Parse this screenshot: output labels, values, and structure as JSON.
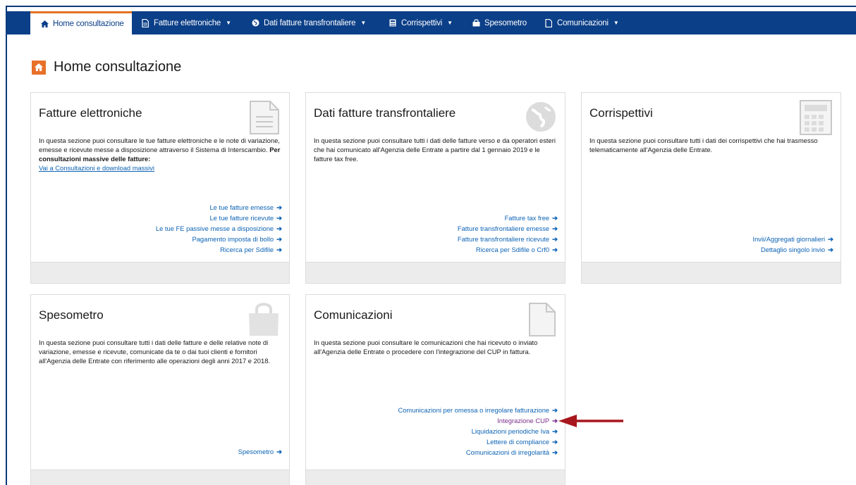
{
  "navbar": {
    "items": [
      {
        "label": "Home consultazione",
        "icon": "home-icon"
      },
      {
        "label": "Fatture elettroniche",
        "icon": "document-icon"
      },
      {
        "label": "Dati fatture transfrontaliere",
        "icon": "globe-icon"
      },
      {
        "label": "Corrispettivi",
        "icon": "calculator-icon"
      },
      {
        "label": "Spesometro",
        "icon": "shopping-bag-icon"
      },
      {
        "label": "Comunicazioni",
        "icon": "file-icon"
      }
    ]
  },
  "page": {
    "title": "Home consultazione"
  },
  "cards": {
    "fatture": {
      "title": "Fatture elettroniche",
      "desc_part1": "In questa sezione puoi consultare le tue fatture elettroniche e le note di variazione, emesse e ricevute messe a disposizione attraverso il Sistema di Interscambio. ",
      "desc_bold": "Per consultazioni massive delle fatture:",
      "desc_link": "Vai a Consultazioni e download massivi",
      "links": [
        "Le tue fatture emesse",
        "Le tue fatture ricevute",
        "Le tue FE passive messe a disposizione",
        "Pagamento imposta di bollo",
        "Ricerca per Sdifile"
      ]
    },
    "transfrontaliere": {
      "title": "Dati fatture transfrontaliere",
      "desc": "In questa sezione puoi consultare tutti i dati delle fatture verso e da operatori esteri che hai comunicato all'Agenzia delle Entrate a partire dal 1 gennaio 2019 e le fatture tax free.",
      "links": [
        "Fatture tax free",
        "Fatture transfrontaliere emesse",
        "Fatture transfrontaliere ricevute",
        "Ricerca per Sdifile o Crf0"
      ]
    },
    "corrispettivi": {
      "title": "Corrispettivi",
      "desc": "In questa sezione puoi consultare tutti i dati dei corrispettivi che hai trasmesso telematicamente all'Agenzia delle Entrate.",
      "links": [
        "Invii/Aggregati giornalieri",
        "Dettaglio singolo invio"
      ]
    },
    "spesometro": {
      "title": "Spesometro",
      "desc": "In questa sezione puoi consultare tutti i dati delle fatture e delle relative note di variazione, emesse e ricevute, comunicate da te o dai tuoi clienti e fornitori all'Agenzia delle Entrate con riferimento alle operazioni degli anni 2017 e 2018.",
      "links": [
        "Spesometro"
      ]
    },
    "comunicazioni": {
      "title": "Comunicazioni",
      "desc": "In questa sezione puoi consultare le comunicazioni che hai ricevuto o inviato all'Agenzia delle Entrate o procedere con l'integrazione del CUP in fattura.",
      "links": [
        "Comunicazioni per omessa o irregolare fatturazione",
        "Integrazione CUP",
        "Liquidazioni periodiche Iva",
        "Lettere di compliance",
        "Comunicazioni di irregolarità"
      ]
    }
  },
  "arrow_glyph": "➔",
  "colors": {
    "nav_bg": "#0b3f88",
    "accent": "#e8702a",
    "link": "#0d63b5",
    "visited": "#7a2f8a",
    "annotation": "#a8171d"
  }
}
